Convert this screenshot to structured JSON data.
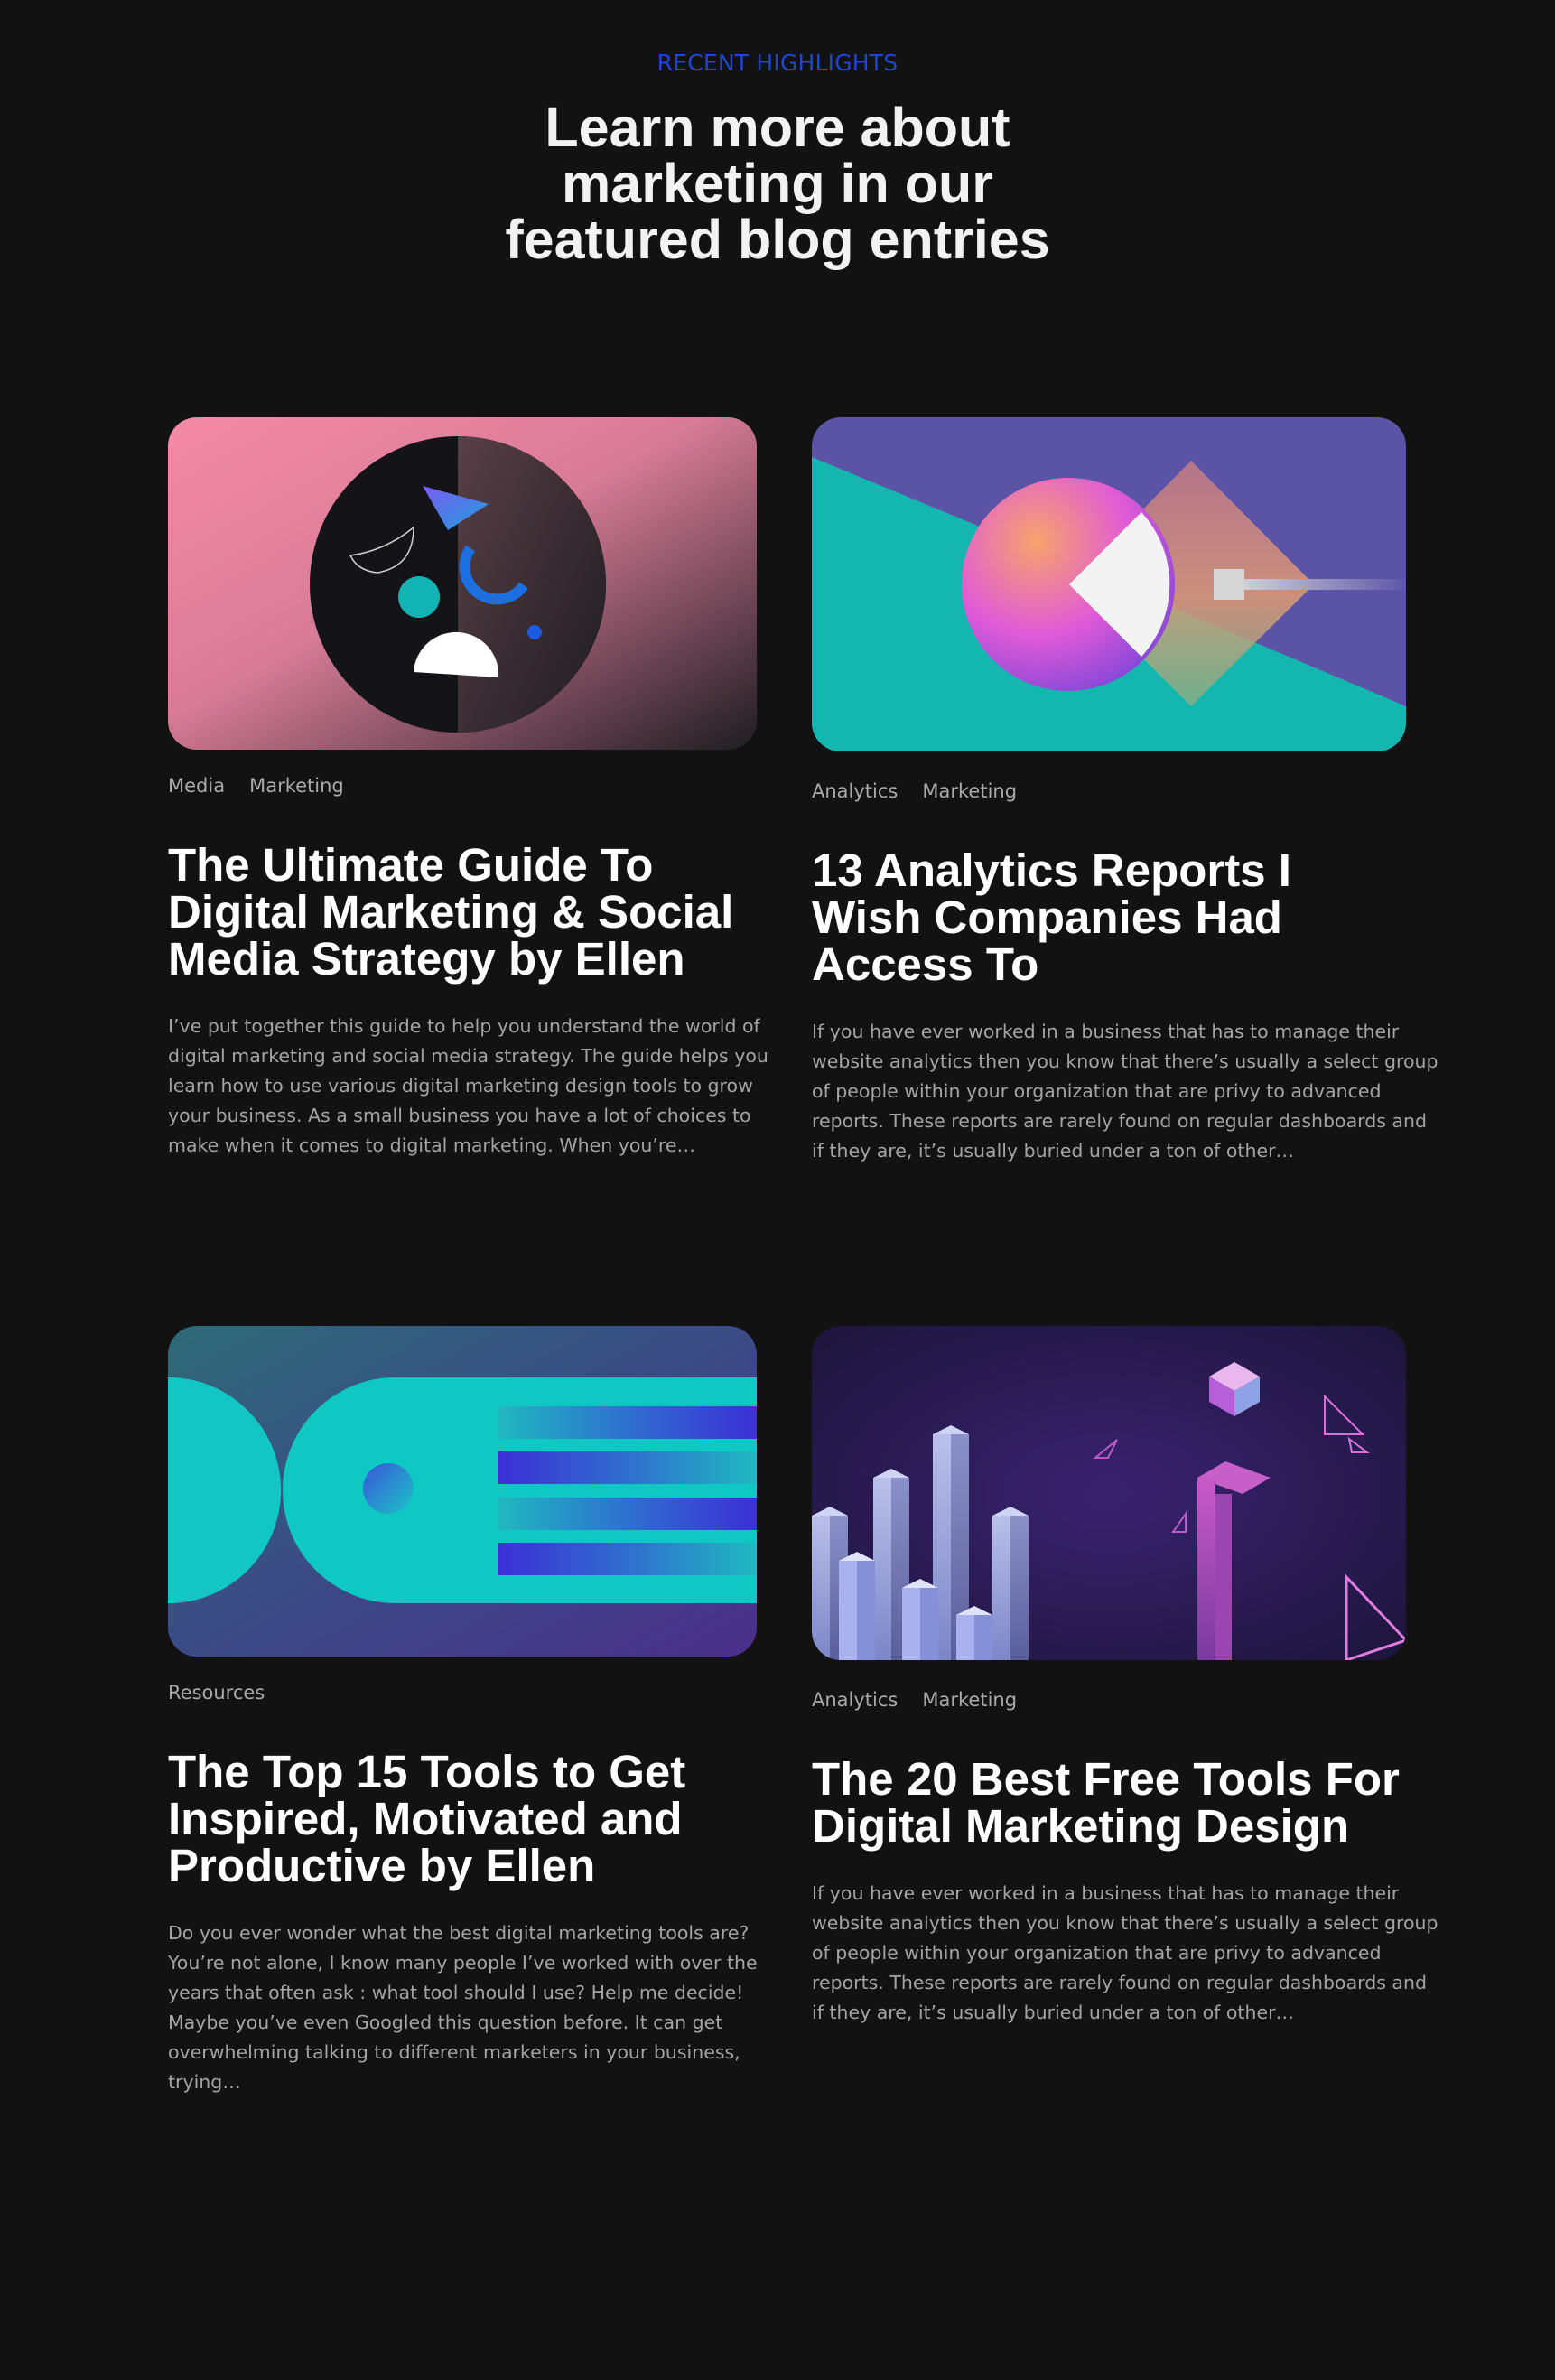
{
  "section": {
    "eyebrow": "RECENT HIGHLIGHTS",
    "headline_lines": [
      "Learn more about",
      "marketing in our",
      "featured blog entries"
    ]
  },
  "posts": [
    {
      "tags": [
        "Media",
        "Marketing"
      ],
      "title_lines": [
        "The Ultimate Guide To",
        "Digital Marketing & Social",
        "Media Strategy by Ellen"
      ],
      "excerpt_lines": [
        "I’ve put together this guide to help you understand the world of",
        "digital marketing and social media strategy. The guide helps you",
        "learn how to use various digital marketing design tools to grow",
        "your business. As a small business you have a lot of choices to",
        "make when it comes to digital marketing. When you’re…"
      ],
      "image": "abstract-shapes-circle-illustration"
    },
    {
      "tags": [
        "Analytics",
        "Marketing"
      ],
      "title_lines": [
        "13 Analytics Reports I",
        "Wish Companies Had",
        "Access To"
      ],
      "excerpt_lines": [
        "If you have ever worked in a business that has to manage their",
        "website analytics then you know that there’s usually a select group",
        "of people within your organization that are privy to advanced",
        "reports. These reports are rarely found on regular dashboards and",
        "if they are, it’s usually buried under a ton of other…"
      ],
      "image": "gradient-circle-diamond-illustration"
    },
    {
      "tags": [
        "Resources"
      ],
      "title_lines": [
        "The Top 15 Tools to Get",
        "Inspired, Motivated and",
        "Productive by Ellen"
      ],
      "excerpt_lines": [
        "Do you ever wonder what the best digital marketing tools are?",
        "You’re not alone, I know many people I’ve worked with over the",
        "years that often ask : what tool should I use? Help me decide!",
        "Maybe you’ve even Googled this question before. It can get",
        "overwhelming talking to different marketers in your business,",
        "trying…"
      ],
      "image": "teal-stripes-illustration"
    },
    {
      "tags": [
        "Analytics",
        "Marketing"
      ],
      "title_lines": [
        "The 20 Best Free Tools For",
        "Digital Marketing Design"
      ],
      "excerpt_lines": [
        "If you have ever worked in a business that has to manage their",
        "website analytics then you know that there’s usually a select group",
        "of people within your organization that are privy to advanced",
        "reports. These reports are rarely found on regular dashboards and",
        "if they are, it’s usually buried under a ton of other…"
      ],
      "image": "isometric-bars-illustration"
    }
  ],
  "colors": {
    "background": "#121212",
    "eyebrow": "#1f45d6",
    "heading": "#ffffff",
    "body_text": "#a4a4a4",
    "tag_text": "#a9a9a9"
  }
}
